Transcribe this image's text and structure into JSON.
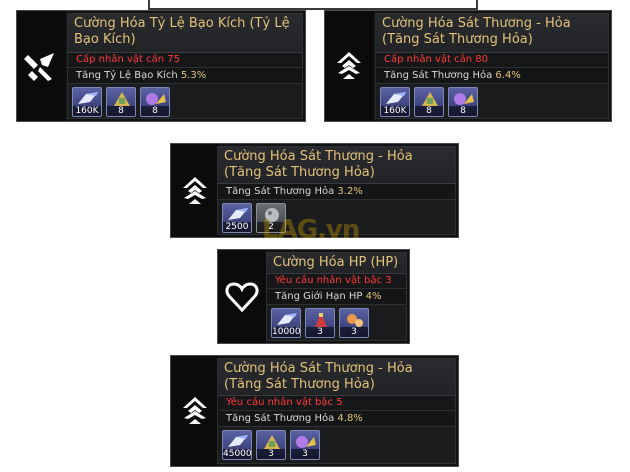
{
  "watermark": "LAG.vn",
  "nodes": [
    {
      "icon": "broken-sword-icon",
      "title": "Cường Hóa Tỷ Lệ Bạo Kích (Tỷ Lệ Bạo Kích)",
      "requirement": "Cấp nhân vật cần 75",
      "effect_label": "Tăng Tỷ Lệ Bạo Kích",
      "effect_value": "5.3%",
      "materials": [
        {
          "icon": "enhancement-stone-icon",
          "count": "160K"
        },
        {
          "icon": "gold-material-icon",
          "count": "8"
        },
        {
          "icon": "purple-material-icon",
          "count": "8"
        }
      ]
    },
    {
      "icon": "fire-emblem-icon",
      "title": "Cường Hóa Sát Thương - Hỏa (Tăng Sát Thương Hỏa)",
      "requirement": "Cấp nhân vật cần 80",
      "effect_label": "Tăng Sát Thương Hỏa",
      "effect_value": "6.4%",
      "materials": [
        {
          "icon": "enhancement-stone-icon",
          "count": "160K"
        },
        {
          "icon": "gold-material-icon",
          "count": "8"
        },
        {
          "icon": "purple-material-icon",
          "count": "8"
        }
      ]
    },
    {
      "icon": "fire-emblem-icon",
      "title": "Cường Hóa Sát Thương - Hỏa (Tăng Sát Thương Hỏa)",
      "effect_label": "Tăng Sát Thương Hỏa",
      "effect_value": "3.2%",
      "materials": [
        {
          "icon": "enhancement-stone-icon",
          "count": "2500"
        },
        {
          "icon": "ore-material-icon",
          "count": "2"
        }
      ]
    },
    {
      "icon": "heart-icon",
      "title": "Cường Hóa HP (HP)",
      "requirement": "Yêu cầu nhân vật bậc 3",
      "effect_label": "Tăng Giới Hạn HP",
      "effect_value": "4%",
      "materials": [
        {
          "icon": "enhancement-stone-icon",
          "count": "10000"
        },
        {
          "icon": "red-material-icon",
          "count": "3"
        },
        {
          "icon": "orange-material-icon",
          "count": "3"
        }
      ]
    },
    {
      "icon": "fire-emblem-icon",
      "title": "Cường Hóa Sát Thương - Hỏa (Tăng Sát Thương Hỏa)",
      "requirement": "Yêu cầu nhân vật bậc 5",
      "effect_label": "Tăng Sát Thương Hỏa",
      "effect_value": "4.8%",
      "materials": [
        {
          "icon": "enhancement-stone-icon",
          "count": "45000"
        },
        {
          "icon": "gold-material-icon",
          "count": "3"
        },
        {
          "icon": "purple-material-icon",
          "count": "3"
        }
      ]
    }
  ]
}
